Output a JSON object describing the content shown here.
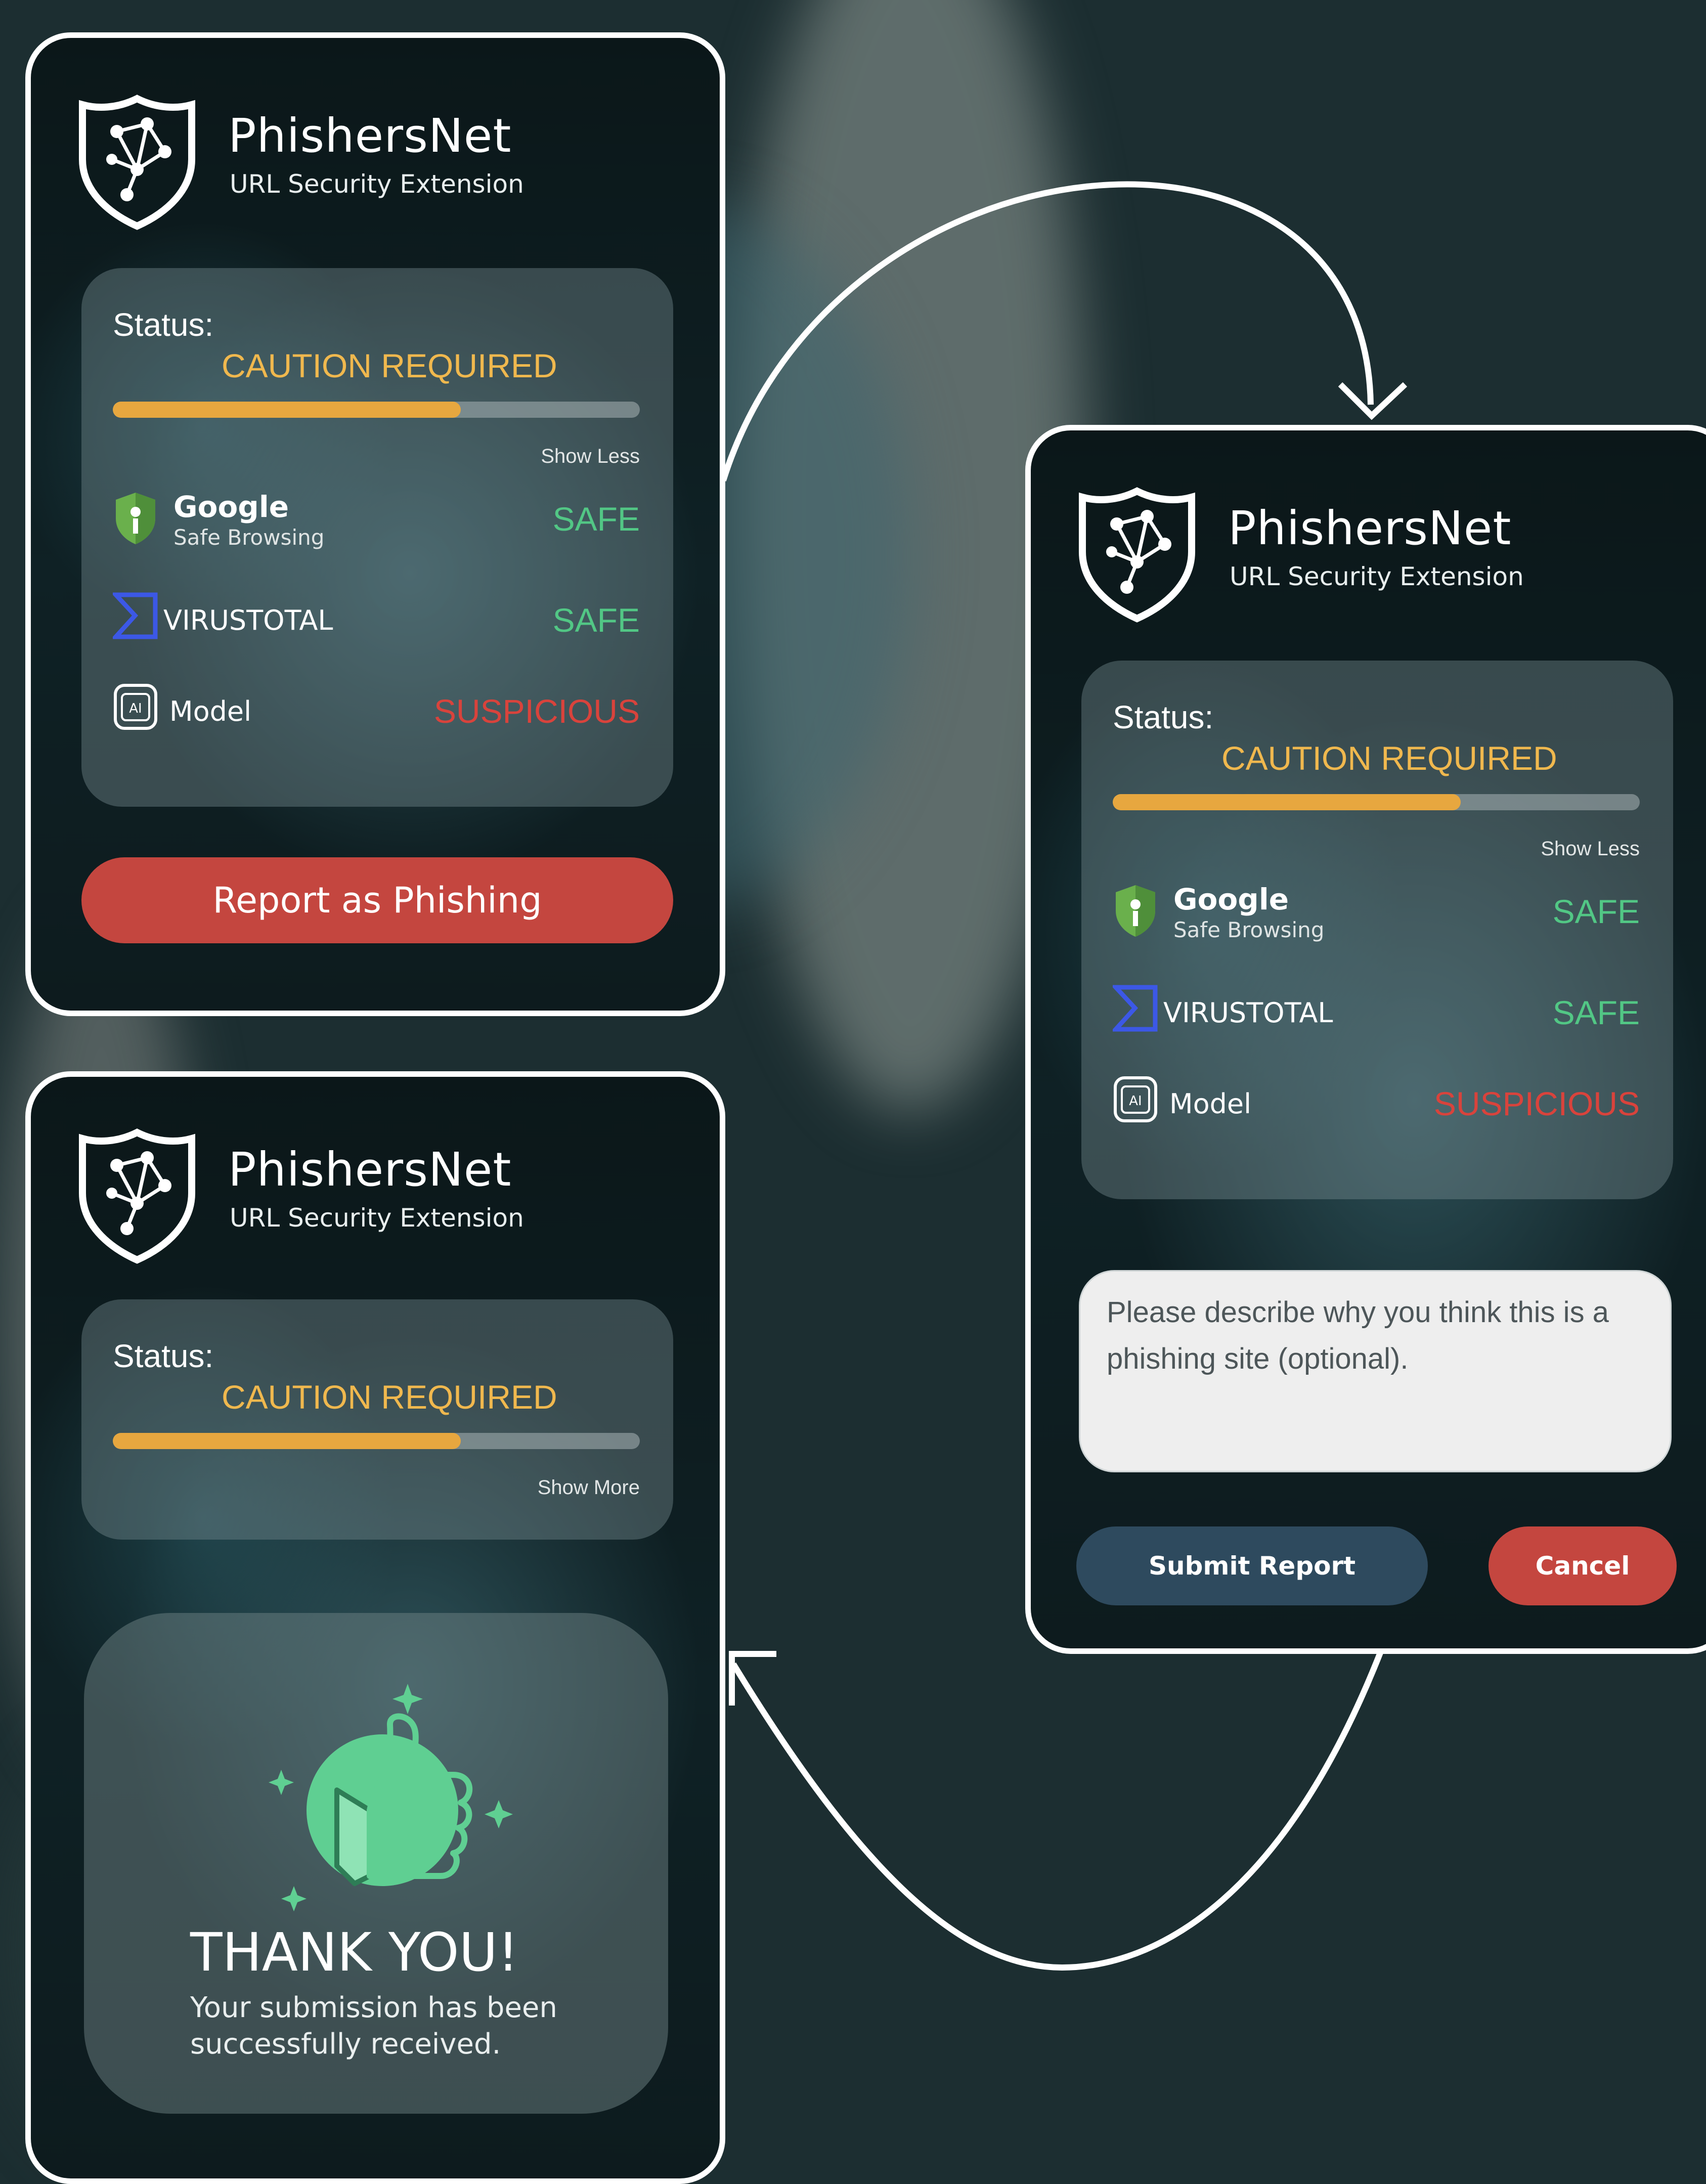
{
  "brand": {
    "name": "PhishersNet",
    "subtitle": "URL Security Extension"
  },
  "status": {
    "label": "Status:",
    "value": "CAUTION REQUIRED",
    "progress_fraction": 0.66,
    "show_less": "Show Less",
    "show_more": "Show More"
  },
  "checks": {
    "google": {
      "name": "Google",
      "sub": "Safe Browsing",
      "result": "SAFE"
    },
    "virustotal": {
      "name": "VIRUSTOTAL",
      "result": "SAFE"
    },
    "model": {
      "icon_text": "AI",
      "name": "Model",
      "result": "SUSPICIOUS"
    }
  },
  "actions": {
    "report": "Report as Phishing",
    "submit": "Submit Report",
    "cancel": "Cancel"
  },
  "report_form": {
    "placeholder": "Please describe why you think this is a phishing site (optional)."
  },
  "thank_you": {
    "title": "THANK YOU!",
    "message": "Your submission has been successfully received."
  },
  "colors": {
    "caution": "#f0b84e",
    "progress": "#e7a73f",
    "safe": "#52c785",
    "suspicious": "#d9433c",
    "danger_button": "#c4463f",
    "submit_button": "#2e4a5e",
    "accent_green": "#5fcf92"
  },
  "icons": [
    "shield-network-logo",
    "google-safe-browsing-shield-icon",
    "virustotal-icon",
    "ai-model-icon",
    "thumbs-up-icon",
    "sparkle-icon"
  ]
}
